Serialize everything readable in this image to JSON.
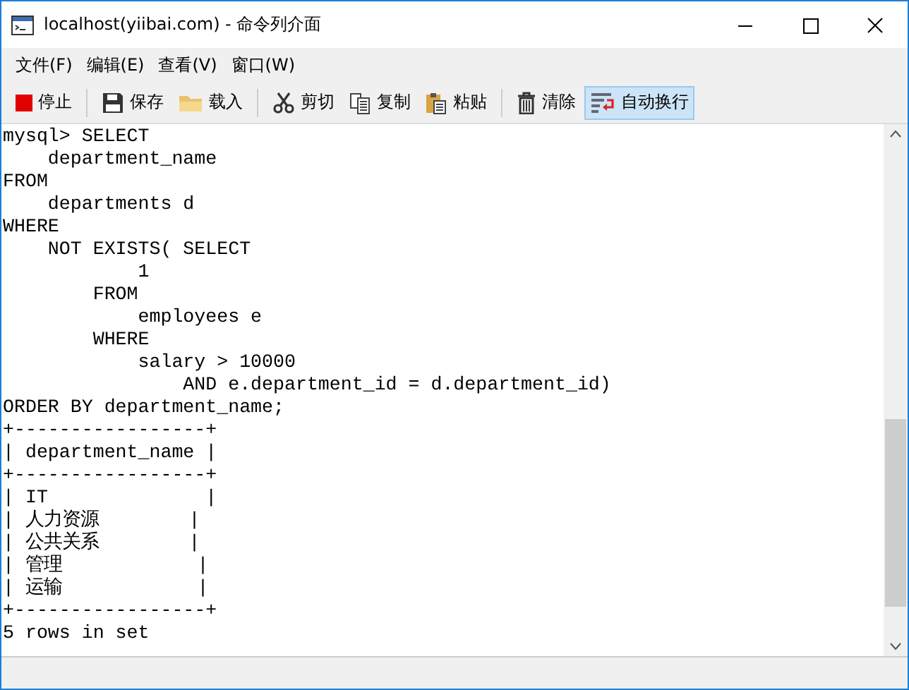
{
  "window": {
    "title": "localhost(yiibai.com) - 命令列介面"
  },
  "menu": [
    {
      "label": "文件(F)"
    },
    {
      "label": "编辑(E)"
    },
    {
      "label": "查看(V)"
    },
    {
      "label": "窗口(W)"
    }
  ],
  "toolbar": [
    {
      "kind": "stop",
      "label": "停止",
      "selected": false
    },
    {
      "kind": "separator"
    },
    {
      "kind": "save",
      "label": "保存",
      "selected": false
    },
    {
      "kind": "load",
      "label": "载入",
      "selected": false
    },
    {
      "kind": "separator"
    },
    {
      "kind": "cut",
      "label": "剪切",
      "selected": false
    },
    {
      "kind": "copy",
      "label": "复制",
      "selected": false
    },
    {
      "kind": "paste",
      "label": "粘贴",
      "selected": false
    },
    {
      "kind": "separator"
    },
    {
      "kind": "clear",
      "label": "清除",
      "selected": false
    },
    {
      "kind": "wrap",
      "label": "自动换行",
      "selected": true
    }
  ],
  "console": {
    "lines": [
      "mysql> SELECT",
      "    department_name",
      "FROM",
      "    departments d",
      "WHERE",
      "    NOT EXISTS( SELECT",
      "            1",
      "        FROM",
      "            employees e",
      "        WHERE",
      "            salary > 10000",
      "                AND e.department_id = d.department_id)",
      "ORDER BY department_name;",
      "+-----------------+",
      "| department_name |",
      "+-----------------+",
      "| IT              |",
      "| 人力资源        |",
      "| 公共关系        |",
      "| 管理            |",
      "| 运输            |",
      "+-----------------+",
      "5 rows in set"
    ]
  }
}
